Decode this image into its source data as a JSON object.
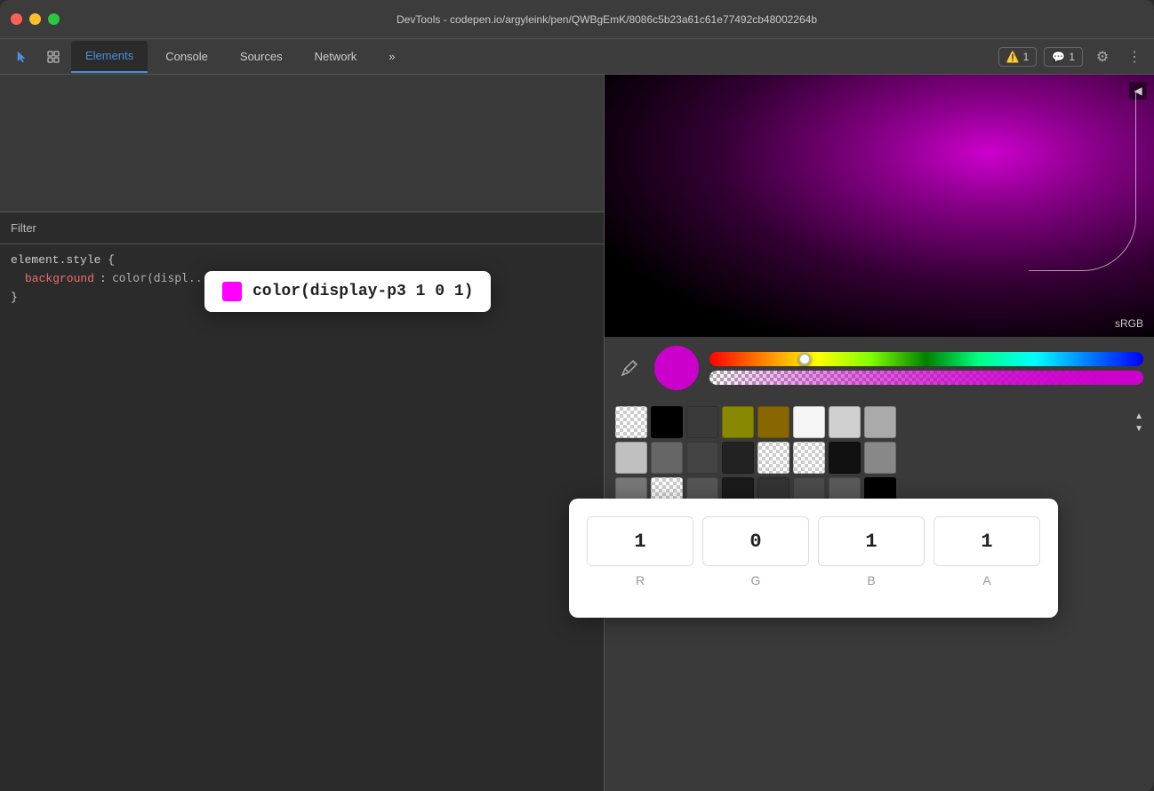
{
  "window": {
    "title": "DevTools - codepen.io/argyleink/pen/QWBgEmK/8086c5b23a61c61e77492cb48002264b"
  },
  "tabs": {
    "items": [
      {
        "id": "elements",
        "label": "Elements",
        "active": true
      },
      {
        "id": "console",
        "label": "Console",
        "active": false
      },
      {
        "id": "sources",
        "label": "Sources",
        "active": false
      },
      {
        "id": "network",
        "label": "Network",
        "active": false
      }
    ],
    "more_label": "»",
    "warning_count": "1",
    "message_count": "1"
  },
  "filter": {
    "label": "Filter"
  },
  "styles": {
    "selector": "element.style {",
    "property": "background",
    "close_brace": "}"
  },
  "tooltip": {
    "color_text": "color(display-p3 1 0 1)"
  },
  "color_picker": {
    "srgb_label": "sRGB",
    "r_value": "1",
    "g_value": "0",
    "b_value": "1",
    "a_value": "1",
    "r_label": "R",
    "g_label": "G",
    "b_label": "B",
    "a_label": "A"
  },
  "swatches": {
    "row1": [
      {
        "color": "transparent",
        "type": "transparent"
      },
      {
        "color": "#000000"
      },
      {
        "color": "#3a3a3a"
      },
      {
        "color": "#888800"
      },
      {
        "color": "#886600"
      },
      {
        "color": "#f5f5f5"
      },
      {
        "color": "#d0d0d0"
      },
      {
        "color": "#aaaaaa"
      }
    ],
    "row2": [
      {
        "color": "#c0c0c0"
      },
      {
        "color": "#666666"
      },
      {
        "color": "#444444"
      },
      {
        "color": "#222222"
      },
      {
        "color": "checker1",
        "type": "checker"
      },
      {
        "color": "checker2",
        "type": "checker"
      },
      {
        "color": "#111111"
      },
      {
        "color": "#888888"
      }
    ],
    "row3": [
      {
        "color": "#777777"
      },
      {
        "color": "checker3",
        "type": "checker2"
      },
      {
        "color": "#555555"
      },
      {
        "color": "#1a1a1a"
      },
      {
        "color": "#333333"
      },
      {
        "color": "#4a4a4a"
      },
      {
        "color": "#5a5a5a"
      },
      {
        "color": "#000000"
      }
    ]
  }
}
